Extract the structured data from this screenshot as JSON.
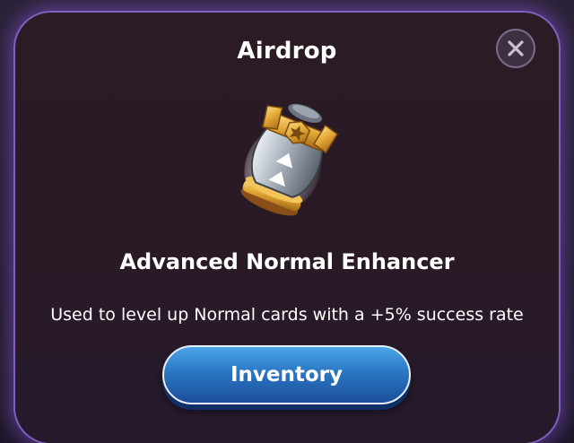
{
  "modal": {
    "title": "Airdrop",
    "item": {
      "icon": "advanced-normal-enhancer-icon",
      "name": "Advanced Normal Enhancer",
      "description": "Used to level up Normal cards with a +5% success rate"
    },
    "inventory_button_label": "Inventory",
    "close_icon": "close-icon"
  },
  "colors": {
    "accent_border": "#9a6edc",
    "button_blue": "#2b76c4",
    "modal_bg": "#2a1a26",
    "gold": "#d9a23a"
  }
}
